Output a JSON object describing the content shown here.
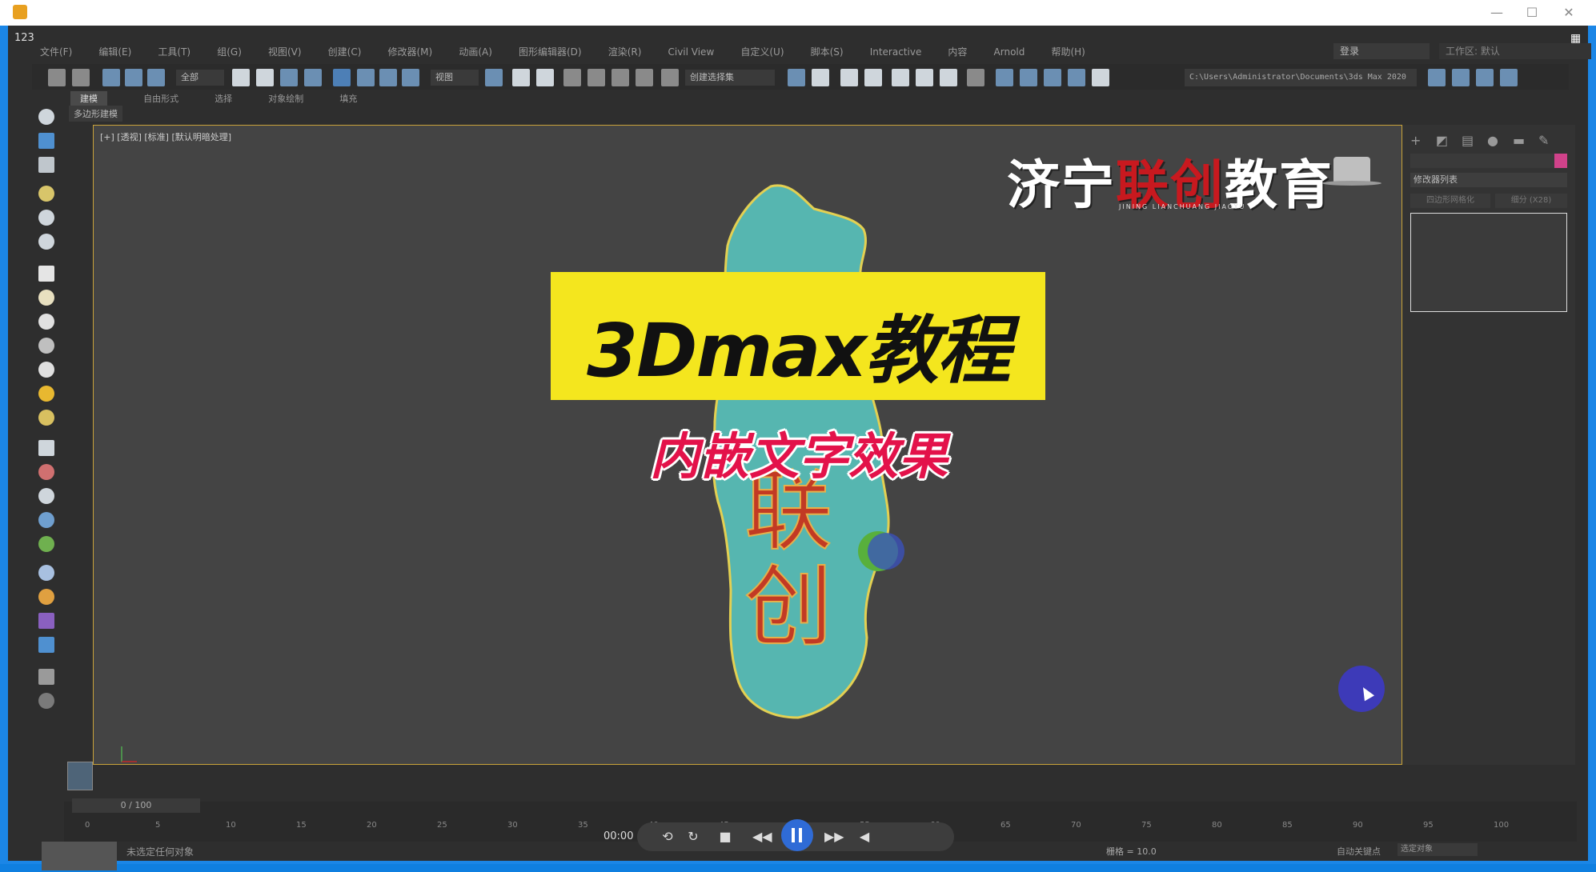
{
  "window": {
    "title": "",
    "minimize": "—",
    "maximize": "☐",
    "close": "✕",
    "app_label": "123"
  },
  "menu": [
    "文件(F)",
    "编辑(E)",
    "工具(T)",
    "组(G)",
    "视图(V)",
    "创建(C)",
    "修改器(M)",
    "动画(A)",
    "图形编辑器(D)",
    "渲染(R)",
    "Civil View",
    "自定义(U)",
    "脚本(S)",
    "Interactive",
    "内容",
    "Arnold",
    "帮助(H)"
  ],
  "login": "登录",
  "workspace": "工作区: 默认",
  "toolbar": {
    "filter": "全部",
    "view_mode": "视图",
    "selection_set": "创建选择集",
    "path": "C:\\Users\\Administrator\\Documents\\3ds Max 2020"
  },
  "ribbon": {
    "tabs": [
      "建模",
      "自由形式",
      "选择",
      "对象绘制",
      "填充"
    ],
    "sub": "多边形建模"
  },
  "viewport_label": "[+] [透视] [标准] [默认明暗处理]",
  "right_panel": {
    "modifier_list": "修改器列表",
    "btn1": "四边形网格化",
    "btn2": "细分 (X28)"
  },
  "overlay": {
    "logo_white_1": "济宁",
    "logo_red": "联创",
    "logo_white_2": "教育",
    "logo_sub": "JINING LIANCHUANG JIAOYU",
    "banner": "3Dmax教程",
    "subtitle": "内嵌文字效果"
  },
  "timeline": {
    "frame": "0 / 100",
    "ticks": [
      "0",
      "5",
      "10",
      "15",
      "20",
      "25",
      "30",
      "35",
      "40",
      "45",
      "50",
      "55",
      "60",
      "65",
      "70",
      "75",
      "80",
      "85",
      "90",
      "95",
      "100"
    ]
  },
  "status": {
    "line1": "未选定任何对象",
    "grid": "栅格 = 10.0",
    "auto_key": "自动关键点",
    "sel": "选定对象"
  },
  "player": {
    "time": "00:00"
  }
}
